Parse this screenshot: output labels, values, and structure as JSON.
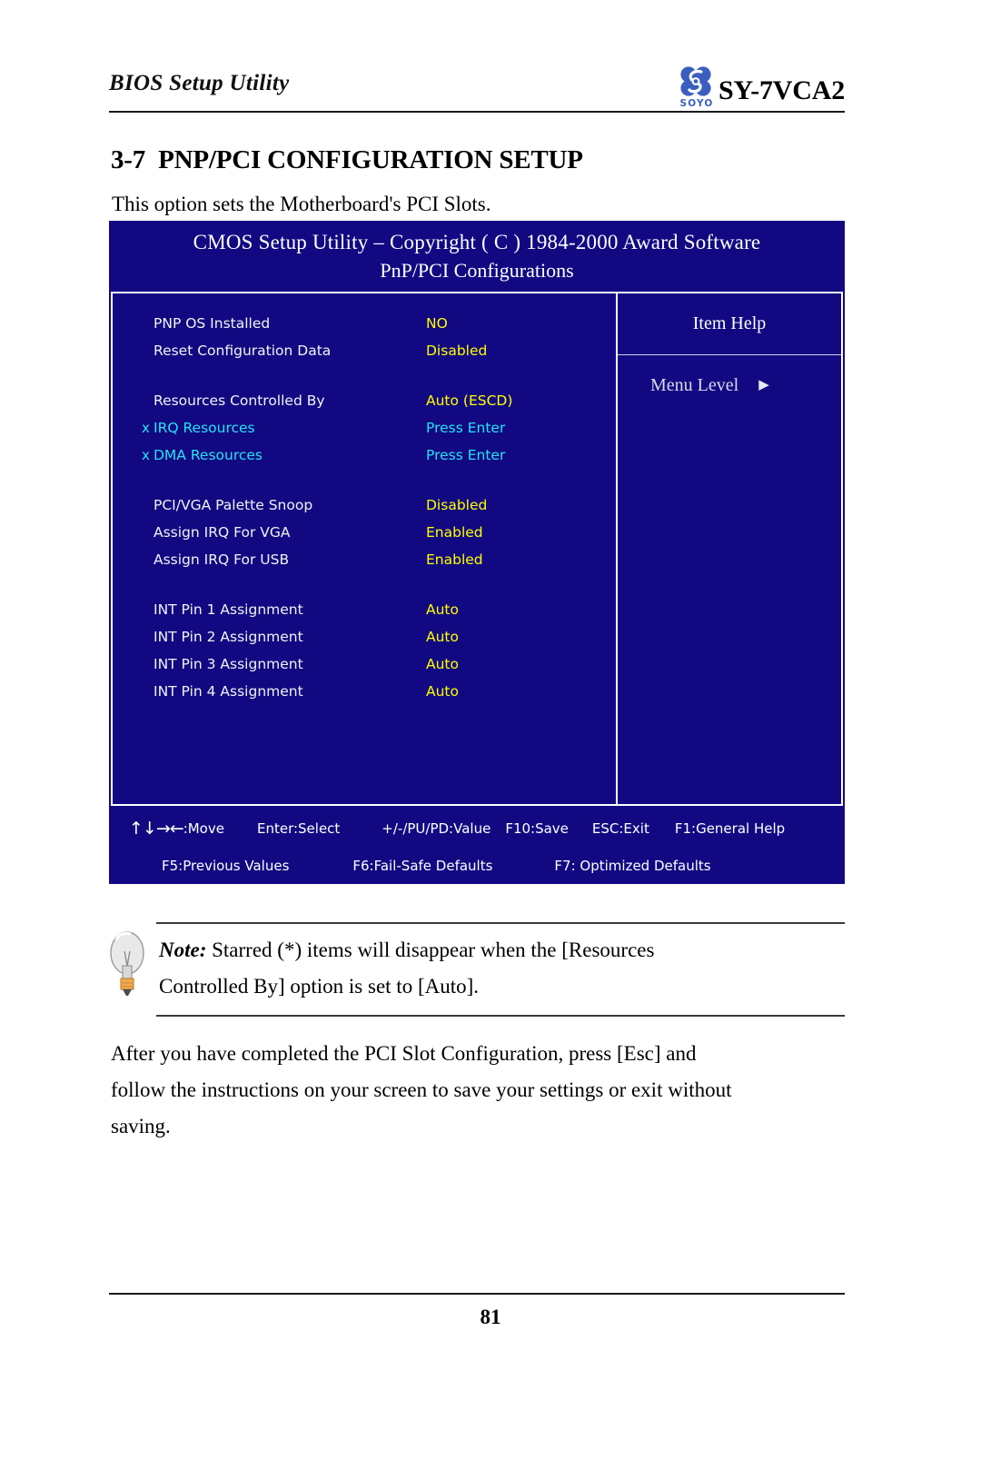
{
  "header": {
    "title": "BIOS Setup Utility",
    "model": "SY-7VCA2",
    "logo_word": "SOYO",
    "logo_icon": "soyo-clover-logo",
    "brand_color": "#3b5fc0"
  },
  "section": {
    "number": "3-7",
    "heading": "PNP/PCI CONFIGURATION SETUP",
    "subtitle": "This option sets the Motherboard's PCI Slots."
  },
  "bios": {
    "title_line1": "CMOS Setup Utility – Copyright ( C ) 1984-2000 Award Software",
    "title_line2": "PnP/PCI Configurations",
    "background_color": "#120982",
    "label_color": "#f2f2f2",
    "value_color": "#ffff00",
    "subitem_color": "#27e2ef",
    "options": [
      {
        "mark": "",
        "label": "PNP OS Installed",
        "value": "NO",
        "sub": false
      },
      {
        "mark": "",
        "label": "Reset Configuration Data",
        "value": "Disabled",
        "sub": false
      },
      {
        "mark": "",
        "label": "",
        "value": "",
        "sub": false,
        "spacer": true
      },
      {
        "mark": "",
        "label": "Resources Controlled By",
        "value": "Auto (ESCD)",
        "sub": false
      },
      {
        "mark": "x",
        "label": "IRQ Resources",
        "value": "Press Enter",
        "sub": true
      },
      {
        "mark": "x",
        "label": "DMA Resources",
        "value": "Press Enter",
        "sub": true
      },
      {
        "mark": "",
        "label": "",
        "value": "",
        "sub": false,
        "spacer": true
      },
      {
        "mark": "",
        "label": "PCI/VGA Palette Snoop",
        "value": "Disabled",
        "sub": false
      },
      {
        "mark": "",
        "label": "Assign IRQ For VGA",
        "value": "Enabled",
        "sub": false
      },
      {
        "mark": "",
        "label": "Assign IRQ For USB",
        "value": "Enabled",
        "sub": false
      },
      {
        "mark": "",
        "label": "",
        "value": "",
        "sub": false,
        "spacer": true
      },
      {
        "mark": "",
        "label": "INT Pin 1 Assignment",
        "value": "Auto",
        "sub": false
      },
      {
        "mark": "",
        "label": "INT Pin 2 Assignment",
        "value": "Auto",
        "sub": false
      },
      {
        "mark": "",
        "label": "INT Pin 3 Assignment",
        "value": "Auto",
        "sub": false
      },
      {
        "mark": "",
        "label": "INT Pin 4 Assignment",
        "value": "Auto",
        "sub": false
      }
    ],
    "help": {
      "title": "Item Help",
      "menu_level_label": "Menu Level",
      "menu_level_arrow": "▶"
    },
    "keys_row1": {
      "arrows": "↑↓→←",
      "move": ":Move",
      "enter": "Enter:Select",
      "value": "+/-/PU/PD:Value",
      "save": "F10:Save",
      "exit": "ESC:Exit",
      "help": "F1:General Help"
    },
    "keys_row2": {
      "previous": "F5:Previous Values",
      "failsafe": "F6:Fail-Safe Defaults",
      "optimized": "F7: Optimized Defaults"
    }
  },
  "note": {
    "icon": "lightbulb-icon",
    "label": "Note:",
    "line1": " Starred (*) items will disappear when the [Resources",
    "line2": "Controlled By] option is set to [Auto]."
  },
  "paragraph": {
    "line1": "After you have completed the PCI Slot Configuration, press [Esc] and",
    "line2": "follow the instructions on your screen to save your settings or exit without",
    "line3": "saving."
  },
  "footer": {
    "page_number": "81"
  }
}
